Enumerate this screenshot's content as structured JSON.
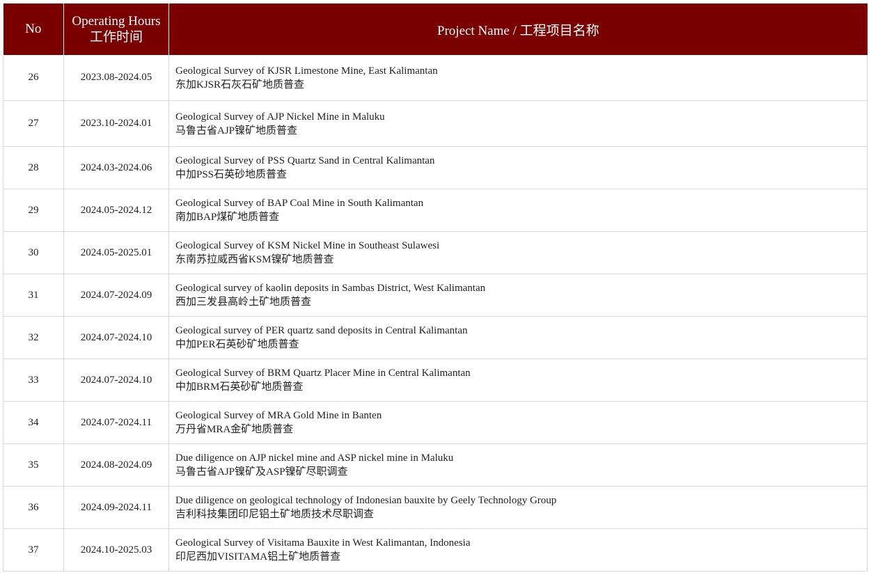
{
  "table": {
    "headers": {
      "no": "No",
      "hours_en": "Operating Hours",
      "hours_cn": "工作时间",
      "project": "Project Name / 工程项目名称"
    },
    "rows": [
      {
        "no": "26",
        "hours": "2023.08-2024.05",
        "en": "Geological Survey of KJSR Limestone Mine, East Kalimantan",
        "cn": "东加KJSR石灰石矿地质普查"
      },
      {
        "no": "27",
        "hours": "2023.10-2024.01",
        "en": "Geological Survey of AJP Nickel Mine in Maluku",
        "cn": "马鲁古省AJP镍矿地质普查"
      },
      {
        "no": "28",
        "hours": "2024.03-2024.06",
        "en": "Geological Survey of PSS Quartz Sand in Central Kalimantan",
        "cn": "中加PSS石英砂地质普查"
      },
      {
        "no": "29",
        "hours": "2024.05-2024.12",
        "en": "Geological Survey of BAP Coal Mine in South Kalimantan",
        "cn": "南加BAP煤矿地质普查"
      },
      {
        "no": "30",
        "hours": "2024.05-2025.01",
        "en": "Geological Survey of KSM Nickel Mine in Southeast Sulawesi",
        "cn": "东南苏拉威西省KSM镍矿地质普查"
      },
      {
        "no": "31",
        "hours": "2024.07-2024.09",
        "en": "Geological survey of kaolin deposits in Sambas District, West Kalimantan",
        "cn": "西加三发县高岭土矿地质普查"
      },
      {
        "no": "32",
        "hours": "2024.07-2024.10",
        "en": "Geological survey of PER quartz sand deposits in Central Kalimantan",
        "cn": "中加PER石英砂矿地质普查"
      },
      {
        "no": "33",
        "hours": "2024.07-2024.10",
        "en": "Geological Survey of BRM Quartz Placer Mine in Central Kalimantan",
        "cn": "中加BRM石英砂矿地质普查"
      },
      {
        "no": "34",
        "hours": "2024.07-2024.11",
        "en": "Geological Survey of MRA Gold Mine in Banten",
        "cn": "万丹省MRA金矿地质普查"
      },
      {
        "no": "35",
        "hours": "2024.08-2024.09",
        "en": "Due diligence on AJP nickel mine and ASP nickel mine in Maluku",
        "cn": "马鲁古省AJP镍矿及ASP镍矿尽职调查"
      },
      {
        "no": "36",
        "hours": "2024.09-2024.11",
        "en": "Due diligence on geological technology of Indonesian bauxite by Geely Technology Group",
        "cn": "吉利科技集团印尼铝土矿地质技术尽职调查"
      },
      {
        "no": "37",
        "hours": "2024.10-2025.03",
        "en": "Geological Survey of Visitama Bauxite in West Kalimantan, Indonesia",
        "cn": "印尼西加VISITAMA铝土矿地质普查"
      }
    ]
  },
  "colors": {
    "header_bg": "#7a0000",
    "header_text": "#ffffff",
    "grid": "#d9d9d9"
  }
}
